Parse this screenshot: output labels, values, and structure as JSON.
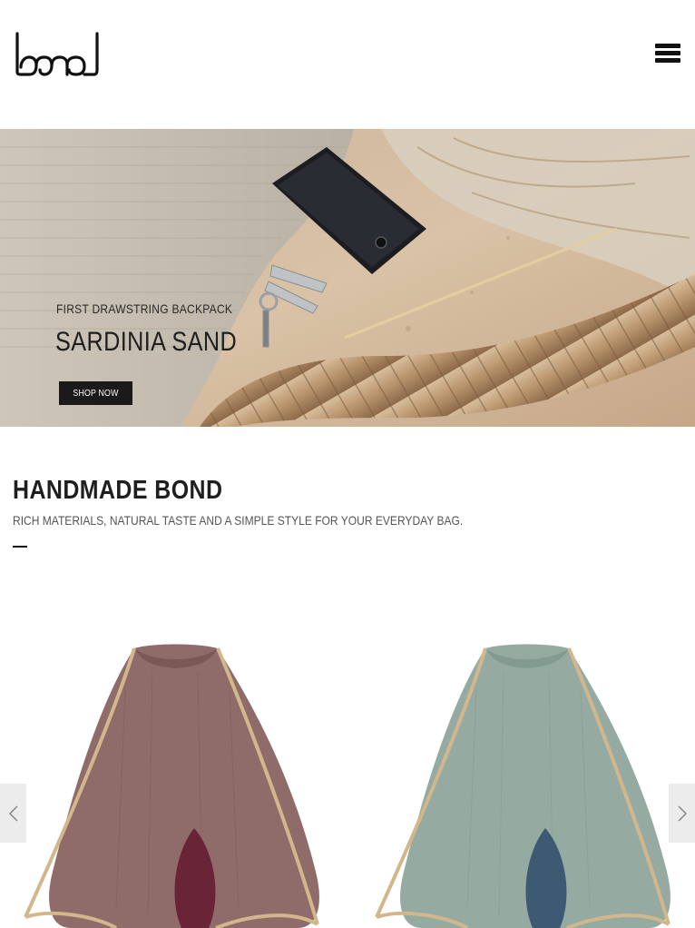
{
  "brand": {
    "logo_text": "bond"
  },
  "header": {
    "menu_icon": "hamburger-icon"
  },
  "hero": {
    "subtitle": "FIRST DRAWSTRING BACKPACK",
    "title": "SARDINIA SAND",
    "button_label": "SHOP NOW"
  },
  "section": {
    "title": "HANDMADE BOND",
    "subtitle": "RICH MATERIALS, NATURAL TASTE AND A SIMPLE STYLE FOR YOUR EVERYDAY BAG."
  },
  "carousel": {
    "prev_icon": "chevron-left-icon",
    "next_icon": "chevron-right-icon",
    "products": [
      {
        "color": "#8f6c6a",
        "lining": "#6a2438"
      },
      {
        "color": "#95aba2",
        "lining": "#3d5a72"
      }
    ]
  }
}
